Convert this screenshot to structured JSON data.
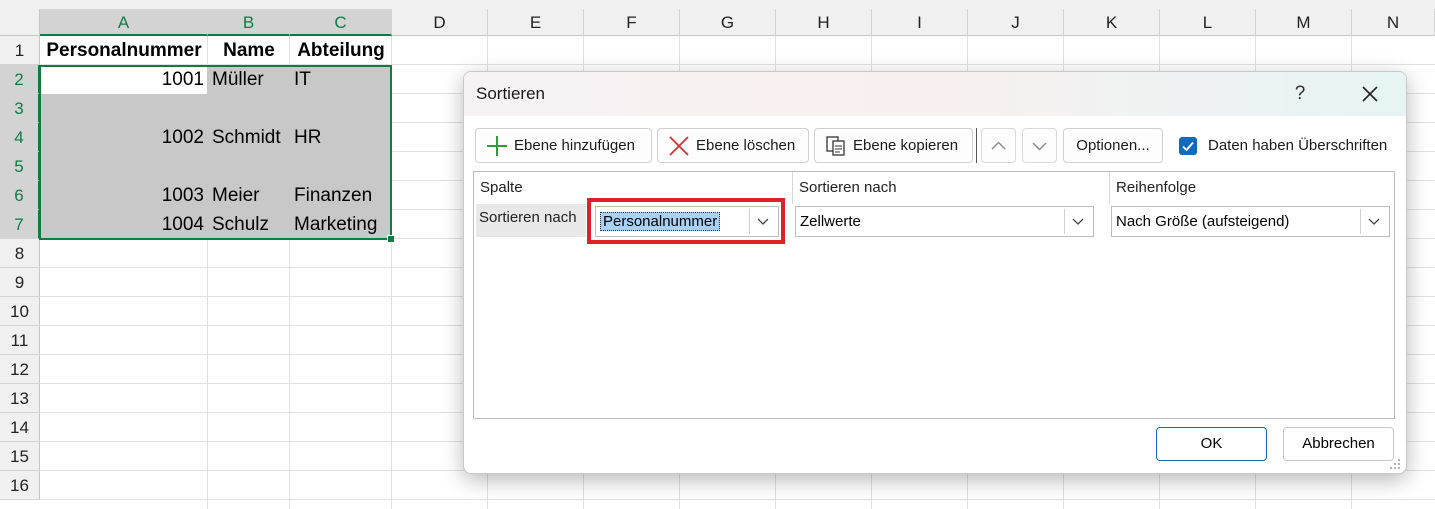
{
  "sheet": {
    "columns": [
      "A",
      "B",
      "C",
      "D",
      "E",
      "F",
      "G",
      "H",
      "I",
      "J",
      "K",
      "L",
      "M",
      "N"
    ],
    "rows": [
      "1",
      "2",
      "3",
      "4",
      "5",
      "6",
      "7",
      "8",
      "9",
      "10",
      "11",
      "12",
      "13",
      "14",
      "15",
      "16"
    ],
    "header": {
      "a": "Personalnummer",
      "b": "Name",
      "c": "Abteilung"
    },
    "data": [
      {
        "a": "1001",
        "b": "Müller",
        "c": "IT"
      },
      {
        "a": "",
        "b": "",
        "c": ""
      },
      {
        "a": "1002",
        "b": "Schmidt",
        "c": "HR"
      },
      {
        "a": "",
        "b": "",
        "c": ""
      },
      {
        "a": "1003",
        "b": "Meier",
        "c": "Finanzen"
      },
      {
        "a": "1004",
        "b": "Schulz",
        "c": "Marketing"
      }
    ]
  },
  "dialog": {
    "title": "Sortieren",
    "help": "?",
    "toolbar": {
      "add_level": "Ebene hinzufügen",
      "delete_level": "Ebene löschen",
      "copy_level": "Ebene kopieren",
      "options": "Optionen...",
      "headers_checkbox": "Daten haben Überschriften"
    },
    "columns_header": {
      "column": "Spalte",
      "sort_on": "Sortieren nach",
      "order": "Reihenfolge"
    },
    "level": {
      "row_label": "Sortieren nach",
      "column_value": "Personalnummer",
      "sort_on_value": "Zellwerte",
      "order_value": "Nach Größe (aufsteigend)"
    },
    "ok": "OK",
    "cancel": "Abbrechen"
  },
  "colors": {
    "accent_green": "#107c41",
    "accent_blue": "#0f6cbd",
    "highlight_red": "#e0202a"
  }
}
